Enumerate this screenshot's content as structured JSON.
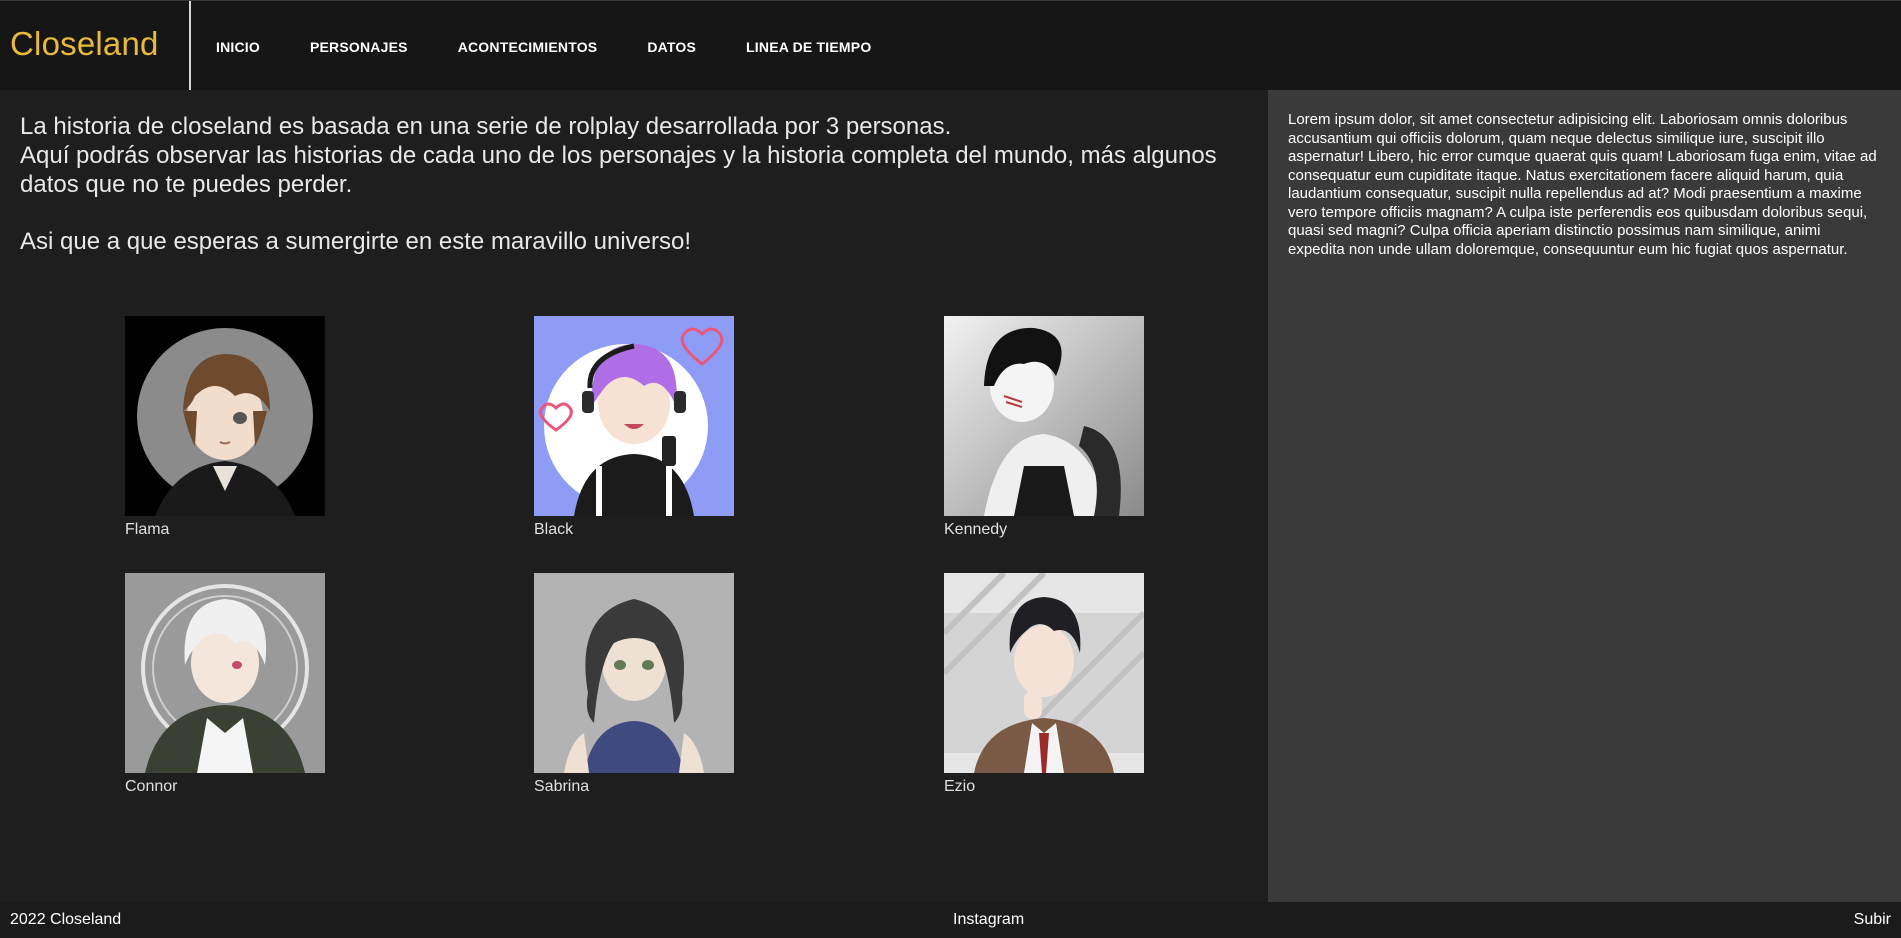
{
  "header": {
    "brand": "Closeland",
    "nav": [
      "INICIO",
      "PERSONAJES",
      "ACONTECIMIENTOS",
      "DATOS",
      "LINEA DE TIEMPO"
    ]
  },
  "intro": {
    "line1": "La historia de closeland es basada en una serie de rolplay desarrollada por 3 personas.",
    "line2": "Aquí podrás observar las historias de cada uno de los personajes y la historia completa del mundo, más algunos datos que no te puedes perder.",
    "line3": "Asi que a que esperas a sumergirte en este maravillo universo!"
  },
  "characters": [
    {
      "name": "Flama",
      "bg": "#000000",
      "accent": "#6e4a2e"
    },
    {
      "name": "Black",
      "bg": "#8e9cf5",
      "accent": "#b06ee6"
    },
    {
      "name": "Kennedy",
      "bg": "#d9d9d9",
      "accent": "#1a1a1a"
    },
    {
      "name": "Connor",
      "bg": "#9a9a9a",
      "accent": "#efefef"
    },
    {
      "name": "Sabrina",
      "bg": "#b3b3b3",
      "accent": "#3a3a3a"
    },
    {
      "name": "Ezio",
      "bg": "#e6e6e6",
      "accent": "#1f1f24"
    }
  ],
  "aside": {
    "text": "Lorem ipsum dolor, sit amet consectetur adipisicing elit. Laboriosam omnis doloribus accusantium qui officiis dolorum, quam neque delectus similique iure, suscipit illo aspernatur! Libero, hic error cumque quaerat quis quam! Laboriosam fuga enim, vitae ad consequatur eum cupiditate itaque. Natus exercitationem facere aliquid harum, quia laudantium consequatur, suscipit nulla repellendus ad at? Modi praesentium a maxime vero tempore officiis magnam? A culpa iste perferendis eos quibusdam doloribus sequi, quasi sed magni? Culpa officia aperiam distinctio possimus nam similique, animi expedita non unde ullam doloremque, consequuntur eum hic fugiat quos aspernatur."
  },
  "footer": {
    "copyright": "2022 Closeland",
    "instagram": "Instagram",
    "up": "Subir"
  },
  "colors": {
    "brand": "#e7b93c",
    "background": "#1e1e1e",
    "aside": "#3a3a3a"
  }
}
